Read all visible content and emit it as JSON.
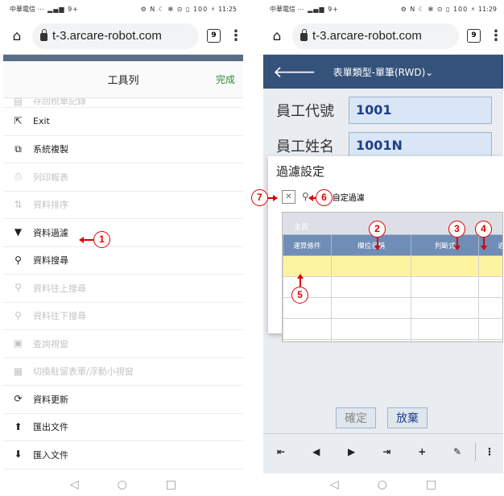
{
  "left": {
    "status": {
      "carrier": "中華電信",
      "icons": "⋯ ▂▄▆ 9+",
      "sys": "⚙ N ☾ ✻ ⊙ ▯ 100 ⚡",
      "time": "11:25"
    },
    "browser": {
      "url": "t-3.arcare-robot.com",
      "tab_count": "9"
    },
    "sheet": {
      "title": "工具列",
      "done": "完成"
    },
    "menu": [
      {
        "label": "存回稅單記錄",
        "icon": "▤",
        "disabled": true
      },
      {
        "label": "Exit",
        "icon": "⇱",
        "disabled": false
      },
      {
        "label": "系統複製",
        "icon": "⧉",
        "disabled": false
      },
      {
        "label": "列印報表",
        "icon": "⎙",
        "disabled": true
      },
      {
        "label": "資料排序",
        "icon": "⇅",
        "disabled": true
      },
      {
        "label": "資料過濾",
        "icon": "▼",
        "disabled": false
      },
      {
        "label": "資料搜尋",
        "icon": "⚲",
        "disabled": false
      },
      {
        "label": "資料往上搜尋",
        "icon": "⚲",
        "disabled": true
      },
      {
        "label": "資料往下搜尋",
        "icon": "⚲",
        "disabled": true
      },
      {
        "label": "查詢視窗",
        "icon": "▣",
        "disabled": true
      },
      {
        "label": "切換駐留表單/浮動小視窗",
        "icon": "▦",
        "disabled": true
      },
      {
        "label": "資料更新",
        "icon": "⟳",
        "disabled": false
      },
      {
        "label": "匯出文件",
        "icon": "⬆",
        "disabled": false
      },
      {
        "label": "匯入文件",
        "icon": "⬇",
        "disabled": false
      }
    ]
  },
  "right": {
    "status": {
      "carrier": "中華電信",
      "icons": "⋯ ▂▄▆ 9+",
      "sys": "⚙ N ☾ ✻ ⊙ ▯ 100 ⚡",
      "time": "11:29"
    },
    "browser": {
      "url": "t-3.arcare-robot.com",
      "tab_count": "9"
    },
    "appbar": {
      "title": "表單類型-單筆(RWD)"
    },
    "form": [
      {
        "label": "員工代號",
        "value": "1001"
      },
      {
        "label": "員工姓名",
        "value": "1001N"
      }
    ],
    "dialog": {
      "title": "過濾設定",
      "custom_filter": "自定過濾",
      "grid_tab": "主頁",
      "columns": [
        "運算條件",
        "欄位名稱",
        "判斷式",
        "過"
      ]
    },
    "form_buttons": [
      "確定",
      "放棄"
    ],
    "toolbar": [
      "⇤",
      "◀",
      "▶",
      "⇥",
      "+",
      "✎",
      "⋮"
    ]
  },
  "callouts": [
    "1",
    "2",
    "3",
    "4",
    "5",
    "6",
    "7"
  ],
  "nav": {
    "back": "◁",
    "home": "○",
    "recent": "□"
  },
  "colors": {
    "appbar": "#34527a",
    "grid_header": "#6f8db6",
    "selected_row": "#fdf49f",
    "callout": "#e00000",
    "done_text": "#2e8b3a"
  }
}
